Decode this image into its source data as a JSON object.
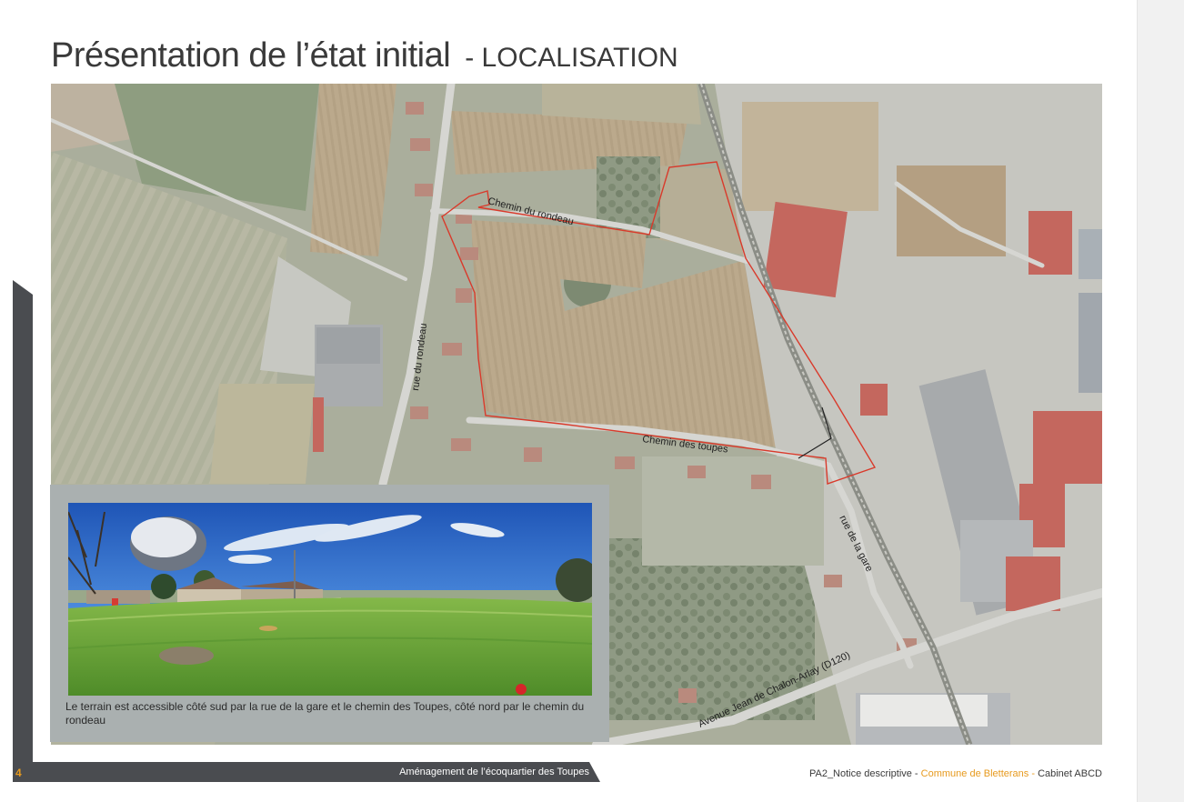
{
  "title": {
    "main": "Présentation de l’état initial",
    "sub": "- LOCALISATION"
  },
  "map": {
    "labels": {
      "chemin_rondeau": "Chemin du rondeau",
      "rue_rondeau": "rue du rondeau",
      "chemin_toupes": "Chemin des toupes",
      "rue_gare": "rue de la gare",
      "avenue": "Avenue Jean de Chalon-Arlay (D120)"
    },
    "colors": {
      "site_boundary": "#d93a2b",
      "field": "#b8a88c",
      "building_red": "#c4675e",
      "road": "#d6d6d2"
    }
  },
  "photo": {
    "caption": "Le terrain est accessible côté sud par la rue de la gare et le chemin des Toupes, côté nord par le chemin du rondeau"
  },
  "footer": {
    "page_number": "4",
    "project": "Aménagement de l’écoquartier des Toupes",
    "doc": "PA2_Notice descriptive",
    "sep1": " - ",
    "commune": "Commune de Bletterans",
    "sep2": " - ",
    "cabinet": "Cabinet ABCD"
  },
  "colors": {
    "accent": "#e79a1e",
    "band": "#4a4c50"
  }
}
